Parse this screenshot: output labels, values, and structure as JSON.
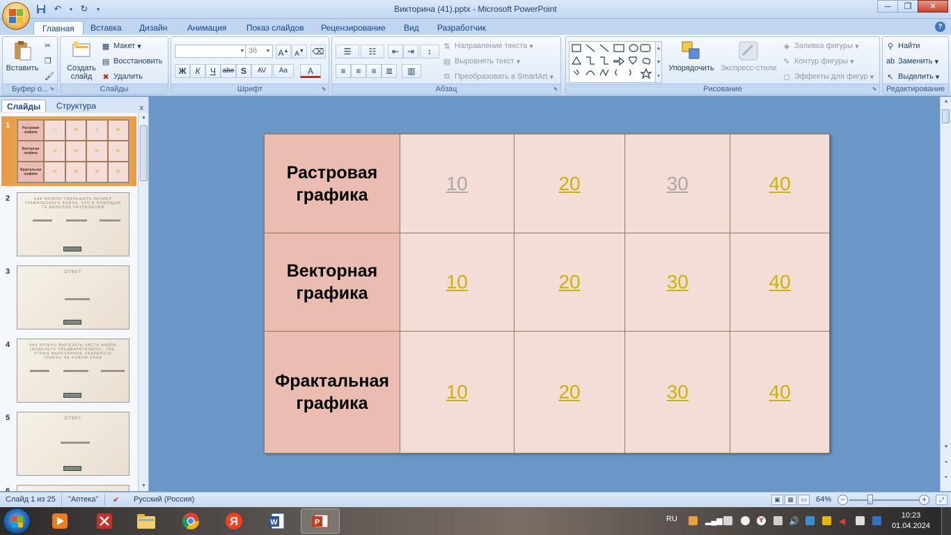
{
  "window": {
    "title": "Викторина (41).pptx - Microsoft PowerPoint",
    "controls": {
      "minimize": "─",
      "maximize": "❐",
      "close": "✕"
    }
  },
  "tabs": [
    "Главная",
    "Вставка",
    "Дизайн",
    "Анимация",
    "Показ слайдов",
    "Рецензирование",
    "Вид",
    "Разработчик"
  ],
  "ribbon": {
    "clipboard": {
      "paste": "Вставить",
      "label": "Буфер о..."
    },
    "slides": {
      "new_slide": "Создать слайд",
      "layout": "Макет",
      "reset": "Восстановить",
      "delete": "Удалить",
      "label": "Слайды"
    },
    "font": {
      "size": "36",
      "bold": "Ж",
      "italic": "К",
      "underline": "Ч",
      "strike": "abe",
      "shadow": "S",
      "spacing": "AV",
      "case": "Aa",
      "color": "A",
      "grow": "A",
      "shrink": "A",
      "label": "Шрифт"
    },
    "paragraph": {
      "text_direction": "Направление текста",
      "align_text": "Выровнять текст",
      "smartart": "Преобразовать в SmartArt",
      "label": "Абзац"
    },
    "drawing": {
      "arrange": "Упорядочить",
      "quick_styles": "Экспресс-стили",
      "fill": "Заливка фигуры",
      "outline": "Контур фигуры",
      "effects": "Эффекты для фигур",
      "label": "Рисование"
    },
    "editing": {
      "find": "Найти",
      "replace": "Заменить",
      "select": "Выделить",
      "label": "Редактирование"
    }
  },
  "pane": {
    "tabs": [
      "Слайды",
      "Структура"
    ],
    "close": "x",
    "slide_numbers": [
      "1",
      "2",
      "3",
      "4",
      "5",
      "6"
    ],
    "thumb_titles": {
      "t2": "КАК МОЖНО УМЕНЬШИТЬ РАЗМЕР ГРАФИЧЕСКОГО ФАЙЛА, ЧТО Б ПОМОЩЬЮ ГЕ МЕНЕНИЯ РАЗРЕШЕНИЯ",
      "t3": "ОТВЕТ",
      "t4": "КАК МОЖНО ВЫРЕЗАТЬ ЧАСТЬ ФАЙЛА (ВИДЕНЕГО ПРЕДВАРИТЕЛЬНО), ТАК, ЧТОБЫ ВЫРЕЗАННОЕ ОКАЗАЛОСЬ ТОЛЬКО НА НОВОМ СЛОЕ",
      "t5": "ОТВЕТ"
    }
  },
  "slide": {
    "categories": [
      "Растровая графика",
      "Векторная графика",
      "Фрактальная графика"
    ],
    "rows": [
      [
        {
          "value": "10",
          "visited": true
        },
        {
          "value": "20",
          "visited": false
        },
        {
          "value": "30",
          "visited": true
        },
        {
          "value": "40",
          "visited": false
        }
      ],
      [
        {
          "value": "10",
          "visited": false
        },
        {
          "value": "20",
          "visited": false
        },
        {
          "value": "30",
          "visited": false
        },
        {
          "value": "40",
          "visited": false
        }
      ],
      [
        {
          "value": "10",
          "visited": false
        },
        {
          "value": "20",
          "visited": false
        },
        {
          "value": "30",
          "visited": false
        },
        {
          "value": "40",
          "visited": false
        }
      ]
    ]
  },
  "status": {
    "slide_info": "Слайд 1 из 25",
    "theme": "\"Аптека\"",
    "language": "Русский (Россия)",
    "zoom": "64%"
  },
  "taskbar": {
    "lang": "RU",
    "time": "10:23",
    "date": "01.04.2024"
  },
  "colors": {
    "category_fill": "#ebbcb0",
    "cell_fill": "#f4ddd6",
    "link": "#c9b400",
    "visited_link": "#a9a9a9"
  }
}
